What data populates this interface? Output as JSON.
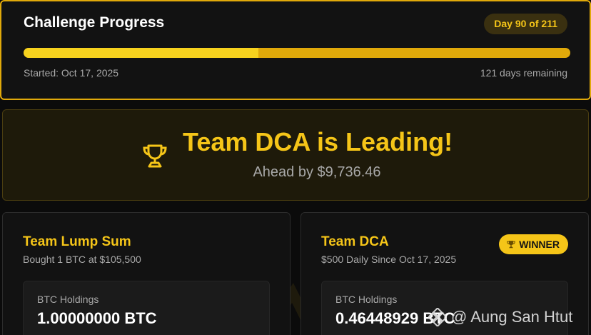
{
  "progress": {
    "title": "Challenge Progress",
    "day_badge": "Day 90 of 211",
    "progress_fraction": 0.43,
    "started": "Started: Oct 17, 2025",
    "remaining": "121 days remaining"
  },
  "leader": {
    "icon": "trophy-icon",
    "title": "Team DCA is Leading!",
    "subtitle": "Ahead by $9,736.46"
  },
  "teams": [
    {
      "name": "Team Lump Sum",
      "subtitle": "Bought 1 BTC at $105,500",
      "holdings_label": "BTC Holdings",
      "holdings_value": "1.00000000 BTC"
    },
    {
      "name": "Team DCA",
      "subtitle": "$500 Daily Since Oct 17, 2025",
      "badge": "WINNER",
      "holdings_label": "BTC Holdings",
      "holdings_value": "0.46448929 BTC"
    }
  ],
  "watermark": "@ Aung San Htut",
  "colors": {
    "accent": "#f5c518",
    "bar_filled": "#f7d21e",
    "bar_track": "#e0a90a",
    "background": "#0b0b0b"
  }
}
